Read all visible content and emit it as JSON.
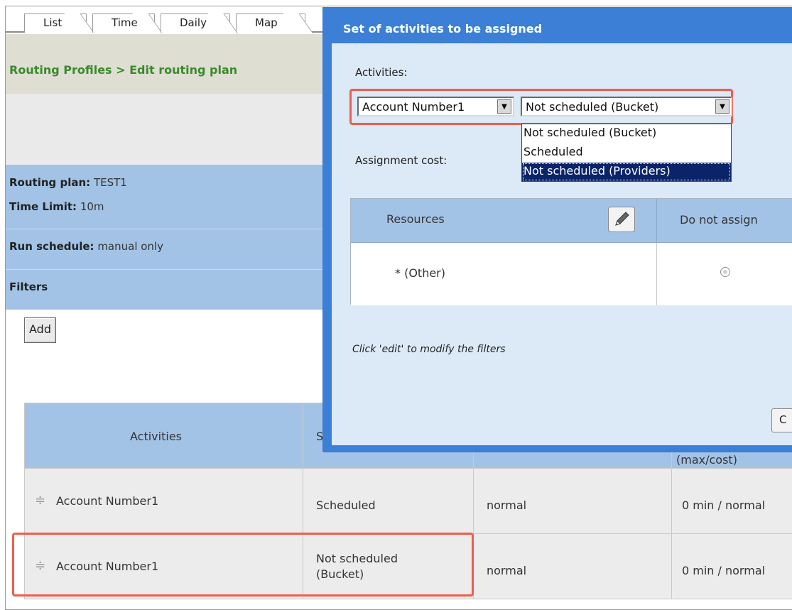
{
  "tabs": [
    "List",
    "Time",
    "Daily",
    "Map"
  ],
  "breadcrumb": "Routing Profiles > Edit routing plan",
  "plan": {
    "routing_label": "Routing plan:",
    "routing_value": "TEST1",
    "time_label": "Time Limit:",
    "time_value": "10m",
    "schedule_label": "Run schedule:",
    "schedule_value": "manual only",
    "filters_label": "Filters"
  },
  "add_label": "Add",
  "table": {
    "headers": [
      "Activities",
      "S",
      "(max/cost)"
    ],
    "rows": [
      {
        "activity": "Account Number1",
        "status": "Scheduled",
        "priority": "normal",
        "limit": "0 min / normal"
      },
      {
        "activity": "Account Number1",
        "status": "Not scheduled (Bucket)",
        "priority": "normal",
        "limit": "0 min / normal"
      }
    ]
  },
  "modal": {
    "title": "Set of activities to be assigned",
    "activities_label": "Activities:",
    "account_select": "Account Number1",
    "status_select": "Not scheduled (Bucket)",
    "status_options": [
      "Not scheduled (Bucket)",
      "Scheduled",
      "Not scheduled (Providers)"
    ],
    "cost_label": "Assignment cost:",
    "resources_header": "Resources",
    "do_not_assign_header": "Do not assign",
    "other_label": "* (Other)",
    "hint": "Click 'edit' to modify the filters",
    "cancel_label": "C"
  },
  "colors": {
    "modal_header": "#3b7fd6",
    "panel_blue": "#a3c3e6",
    "breadcrumb_green": "#3a8a2a",
    "highlight": "#ef5d4e",
    "dropdown_selected": "#0a246a"
  }
}
